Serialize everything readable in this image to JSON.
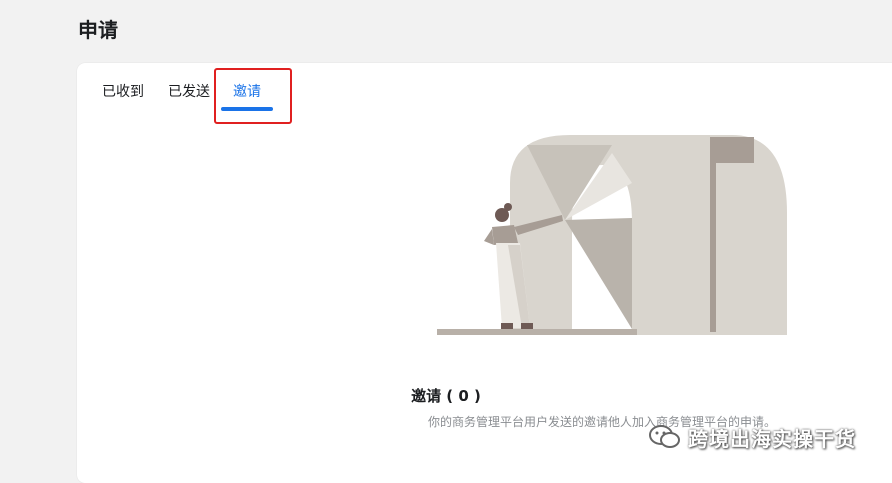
{
  "page": {
    "title": "申请"
  },
  "tabs": [
    {
      "label": "已收到"
    },
    {
      "label": "已发送"
    },
    {
      "label": "邀请"
    }
  ],
  "empty_state": {
    "title": "邀请 ( 0 )",
    "description": "你的商务管理平台用户发送的邀请他人加入商务管理平台的申请。"
  },
  "watermark": {
    "text": "跨境出海实操干货",
    "icon": "wechat-icon"
  },
  "colors": {
    "accent": "#1a73e8",
    "highlight": "#e02020",
    "background": "#f2f2f2"
  }
}
